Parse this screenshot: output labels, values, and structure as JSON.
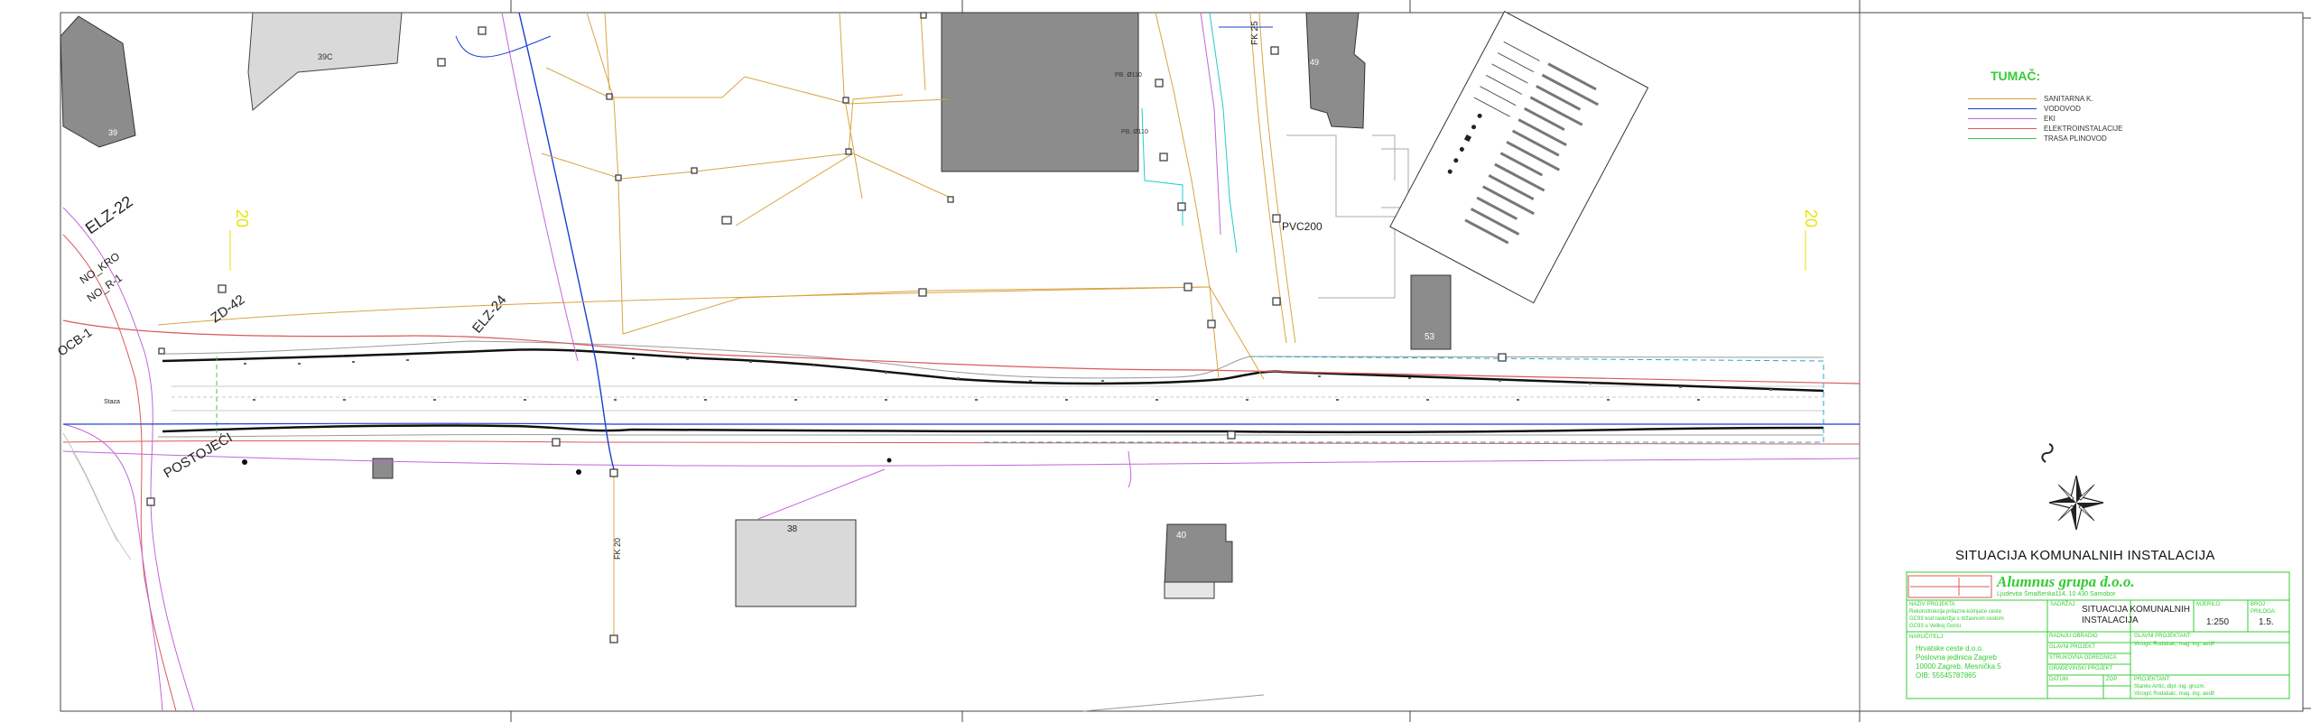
{
  "legend": {
    "title": "TUMAČ:",
    "items": [
      {
        "label": "SANITARNA K.",
        "color": "#d9a441"
      },
      {
        "label": "VODOVOD",
        "color": "#1a3fd1"
      },
      {
        "label": "EKI",
        "color": "#c266d9"
      },
      {
        "label": "ELEKTROINSTALACIJE",
        "color": "#d95a5a"
      },
      {
        "label": "TRASA PLINOVOD",
        "color": "#33cc55"
      }
    ]
  },
  "drawing": {
    "title": "SITUACIJA KOMUNALNIH INSTALACIJA",
    "buildings": [
      "39C",
      "39",
      "49",
      "53",
      "38",
      "40"
    ],
    "line_labels": [
      "ELZ-22",
      "ZD-42",
      "ELZ-24",
      "FK 25",
      "FK 20",
      "PVC200",
      "PB. Ø110",
      "PB. Ø110"
    ],
    "street_labels": [
      "POSTOJEĆI",
      "Staza"
    ],
    "stationing": [
      "20",
      "20"
    ],
    "side_labels": [
      "NO_KRO",
      "NO_R-1",
      "OCB-1"
    ]
  },
  "title_block": {
    "company": "Alumnus grupa d.o.o.",
    "company_address": "Ljudevita Šmalšenka114, 10 430 Samobor",
    "naziv_projekta_label": "NAZIV PROJEKTA",
    "naziv_projekta_lines": [
      "Rekonstrukcija prilazne-kolnjače ceste",
      "GC93 kod raskrižja s državnom cestom",
      "GC93 u Velikoj Gorici"
    ],
    "sadrzaj_label": "SADRŽAJ:",
    "sadrzaj_value_1": "SITUACIJA KOMUNALNIH",
    "sadrzaj_value_2": "INSTALACIJA",
    "mjerilo_label": "MJERILO:",
    "mjerilo_value": "1:250",
    "broj_priloga_label": "BROJ PRILOGA:",
    "broj_priloga_value": "1.5.",
    "narucitelj_label": "NARUČITELJ:",
    "narucitelj_lines": [
      "Hrvatske ceste d.o.o.",
      "Poslovna jedinica Zagreb",
      "10000 Zagreb, Mesnička 5",
      "OIB: 55545787865"
    ],
    "left_rows": [
      "RADNJU OBRADIO",
      "GLAVNI PROJEKT",
      "STRUKOVNA ODREDNICA",
      "GRAĐEVINSKI PROJEKT",
      "DATUM",
      "ZOP"
    ],
    "glavni_projektant_label": "GLAVNI PROJEKTANT:",
    "glavni_projektant_value": "Vinogić Rodatiaic, mag. ing. aedif",
    "projektant_label": "PROJEKTANT:",
    "projektant_value_1": "Stanko Antić, dipl. ing. grozm.",
    "projektant_value_2": "Vinogić Rodatiaic, mag. ing. aedif"
  }
}
